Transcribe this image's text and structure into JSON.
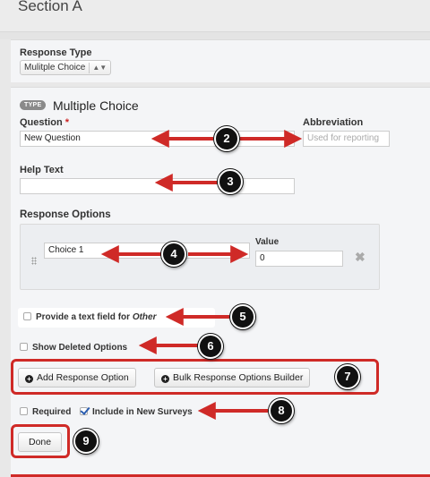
{
  "window": {
    "title": "Section A"
  },
  "response_type": {
    "label": "Response Type",
    "selected": "Mulitple Choice"
  },
  "question_panel": {
    "type_badge": "TYPE",
    "type_title": "Multiple Choice",
    "question_label": "Question",
    "required_marker": "*",
    "question_value": "New Question",
    "abbreviation_label": "Abbreviation",
    "abbreviation_placeholder": "Used for reporting",
    "help_text_label": "Help Text",
    "help_text_value": "",
    "response_options_label": "Response Options",
    "options": [
      {
        "choice": "Choice 1",
        "value_label": "Value",
        "value": "0",
        "delete_icon": "close-icon"
      }
    ],
    "other_field_text": "Provide a text field for ",
    "other_field_emphasis": "Other",
    "show_deleted_text": "Show Deleted Options",
    "add_response_label": "Add Response Option",
    "bulk_builder_label": "Bulk Response Options Builder",
    "required_text": "Required",
    "required_checked": false,
    "include_new_text": "Include in New Surveys",
    "include_new_checked": true,
    "done_label": "Done"
  },
  "annotations": {
    "markers": [
      "2",
      "3",
      "4",
      "5",
      "6",
      "7",
      "8",
      "9"
    ],
    "accent_color": "#cf2a27"
  }
}
